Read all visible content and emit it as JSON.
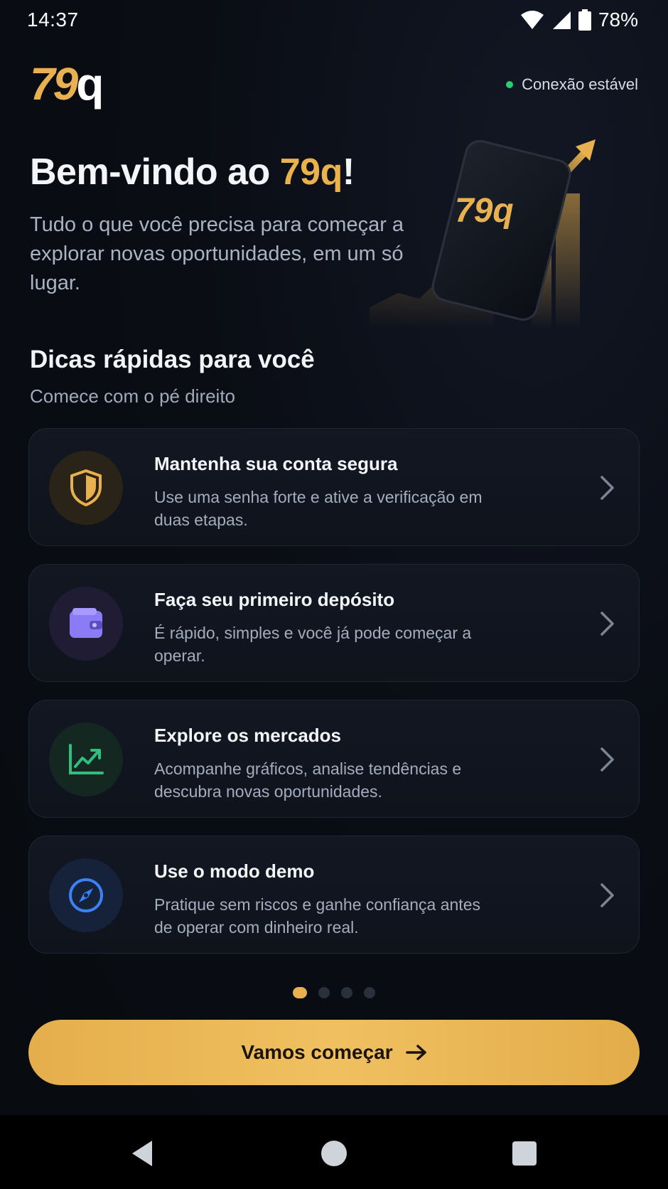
{
  "status_bar": {
    "time": "14:37",
    "battery_percent": "78%",
    "icons": [
      "wifi-icon",
      "cell-signal-icon",
      "battery-icon"
    ]
  },
  "header": {
    "logo_digits": "79",
    "logo_letter": "q",
    "connection_status": "Conexão estável",
    "connection_color": "#2ecc71"
  },
  "hero": {
    "title_prefix": "Bem-vindo ao ",
    "title_brand": "79q",
    "title_suffix": "!",
    "subtitle": "Tudo o que você precisa para começar a explorar novas oportunidades, em um só lugar.",
    "illustration_logo": "79q"
  },
  "tips": {
    "title": "Dicas rápidas para você",
    "subtitle": "Comece com o pé direito",
    "items": [
      {
        "title": "Mantenha sua conta segura",
        "description": "Use uma senha forte e ative a verificação em duas etapas.",
        "icon": "shield-icon",
        "icon_color": "#e8b04e",
        "icon_bg": "#2a2418"
      },
      {
        "title": "Faça seu primeiro depósito",
        "description": "É rápido, simples e você já pode começar a operar.",
        "icon": "wallet-icon",
        "icon_color": "#8b7cf6",
        "icon_bg": "#1f1c33"
      },
      {
        "title": "Explore os mercados",
        "description": "Acompanhe gráficos, analise tendências e descubra novas oportunidades.",
        "icon": "chart-trend-icon",
        "icon_color": "#2fbf7f",
        "icon_bg": "#142821"
      },
      {
        "title": "Use o modo demo",
        "description": "Pratique sem riscos e ganhe confiança antes de operar com dinheiro real.",
        "icon": "compass-icon",
        "icon_color": "#3b82f6",
        "icon_bg": "#15223a"
      }
    ]
  },
  "pagination": {
    "current": 1,
    "total": 4
  },
  "cta": {
    "label": "Vamos começar",
    "icon": "arrow-right-icon"
  },
  "nav": {
    "icons": [
      "back-icon",
      "home-icon",
      "recents-icon"
    ]
  }
}
